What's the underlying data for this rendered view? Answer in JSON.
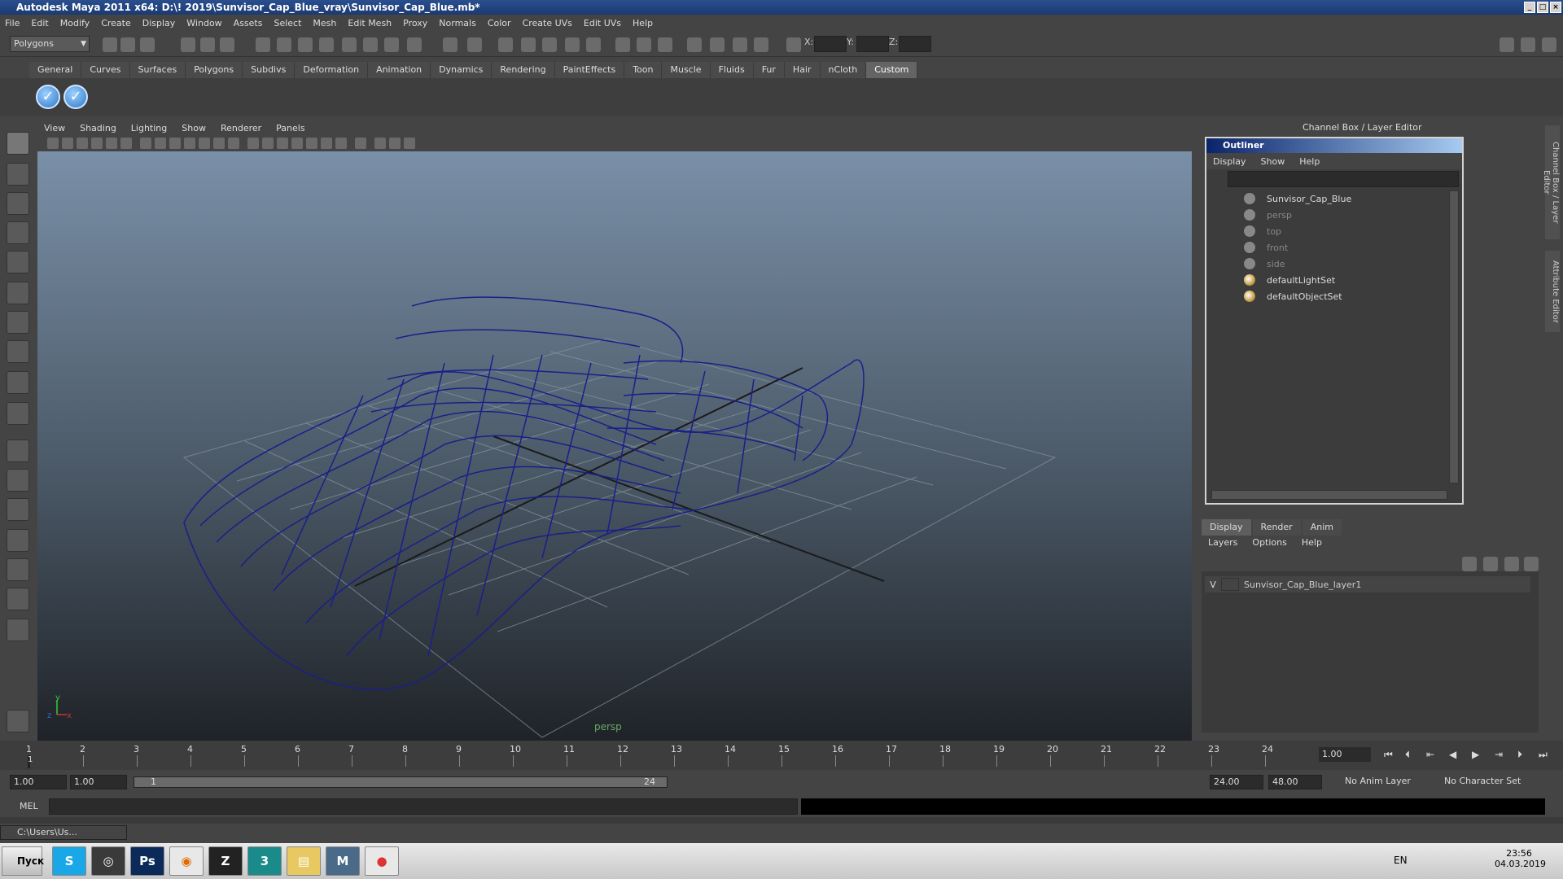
{
  "title": "Autodesk Maya 2011 x64: D:\\! 2019\\Sunvisor_Cap_Blue_vray\\Sunvisor_Cap_Blue.mb*",
  "menu": [
    "File",
    "Edit",
    "Modify",
    "Create",
    "Display",
    "Window",
    "Assets",
    "Select",
    "Mesh",
    "Edit Mesh",
    "Proxy",
    "Normals",
    "Color",
    "Create UVs",
    "Edit UVs",
    "Help"
  ],
  "status": {
    "mode": "Polygons",
    "x_label": "X:",
    "y_label": "Y:",
    "z_label": "Z:"
  },
  "shelf_tabs": [
    "General",
    "Curves",
    "Surfaces",
    "Polygons",
    "Subdivs",
    "Deformation",
    "Animation",
    "Dynamics",
    "Rendering",
    "PaintEffects",
    "Toon",
    "Muscle",
    "Fluids",
    "Fur",
    "Hair",
    "nCloth",
    "Custom"
  ],
  "shelf_active": "Custom",
  "viewport": {
    "menu": [
      "View",
      "Shading",
      "Lighting",
      "Show",
      "Renderer",
      "Panels"
    ],
    "camera_label": "persp",
    "axis_y": "y",
    "axis_x": "x",
    "axis_z": "z"
  },
  "channel_box_title": "Channel Box / Layer Editor",
  "outliner": {
    "title": "Outliner",
    "menu": [
      "Display",
      "Show",
      "Help"
    ],
    "items": [
      {
        "label": "Sunvisor_Cap_Blue",
        "type": "mesh"
      },
      {
        "label": "persp",
        "type": "camera"
      },
      {
        "label": "top",
        "type": "camera"
      },
      {
        "label": "front",
        "type": "camera"
      },
      {
        "label": "side",
        "type": "camera"
      },
      {
        "label": "defaultLightSet",
        "type": "set"
      },
      {
        "label": "defaultObjectSet",
        "type": "set"
      }
    ]
  },
  "layers": {
    "tabs": [
      "Display",
      "Render",
      "Anim"
    ],
    "active_tab": "Display",
    "menu": [
      "Layers",
      "Options",
      "Help"
    ],
    "rows": [
      {
        "visible": "V",
        "name": "Sunvisor_Cap_Blue_layer1"
      }
    ]
  },
  "side_tabs": [
    "Channel Box / Layer Editor",
    "Attribute Editor"
  ],
  "timeline": {
    "ticks": [
      "1",
      "2",
      "3",
      "4",
      "5",
      "6",
      "7",
      "8",
      "9",
      "10",
      "11",
      "12",
      "13",
      "14",
      "15",
      "16",
      "17",
      "18",
      "19",
      "20",
      "21",
      "22",
      "23",
      "24"
    ],
    "current": "1.00",
    "current_marker": "1"
  },
  "range": {
    "start": "1.00",
    "inner_start": "1.00",
    "slider_start": "1",
    "slider_end": "24",
    "end": "24.00",
    "max": "48.00",
    "anim_layer": "No Anim Layer",
    "char_set": "No Character Set"
  },
  "mel_label": "MEL",
  "minimized_window": "C:\\Users\\Us...",
  "taskbar": {
    "start": "Пуск",
    "lang": "EN",
    "time": "23:56",
    "date": "04.03.2019"
  }
}
